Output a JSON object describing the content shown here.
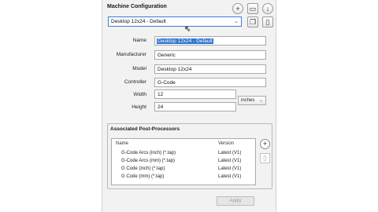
{
  "panel": {
    "title": "Machine Configuration",
    "selected_machine": "Desktop 12x24 - Default",
    "icons": [
      "add-icon",
      "folder-open-icon",
      "download-icon",
      "copy-icon",
      "delete-icon"
    ]
  },
  "fields": {
    "name_label": "Name",
    "name_value": "Desktop 12x24 - Default",
    "manufacturer_label": "Manufacturer",
    "manufacturer_value": "Generic",
    "model_label": "Model",
    "model_value": "Desktop 12x24",
    "controller_label": "Controller",
    "controller_value": "G-Code",
    "width_label": "Width",
    "width_value": "12",
    "height_label": "Height",
    "height_value": "24",
    "units_value": "inches"
  },
  "postprocessors": {
    "title": "Associated Post-Processors",
    "col_name": "Name",
    "col_version": "Version",
    "rows": [
      {
        "name": "G-Code Arcs (inch) (*.tap)",
        "version": "Latest (V1)"
      },
      {
        "name": "G-Code Arcs (mm) (*.tap)",
        "version": "Latest (V1)"
      },
      {
        "name": "G Code (inch) (*.tap)",
        "version": "Latest (V1)"
      },
      {
        "name": "G Code (mm) (*.tap)",
        "version": "Latest (V1)"
      }
    ]
  },
  "footer": {
    "apply_label": "Apply"
  }
}
